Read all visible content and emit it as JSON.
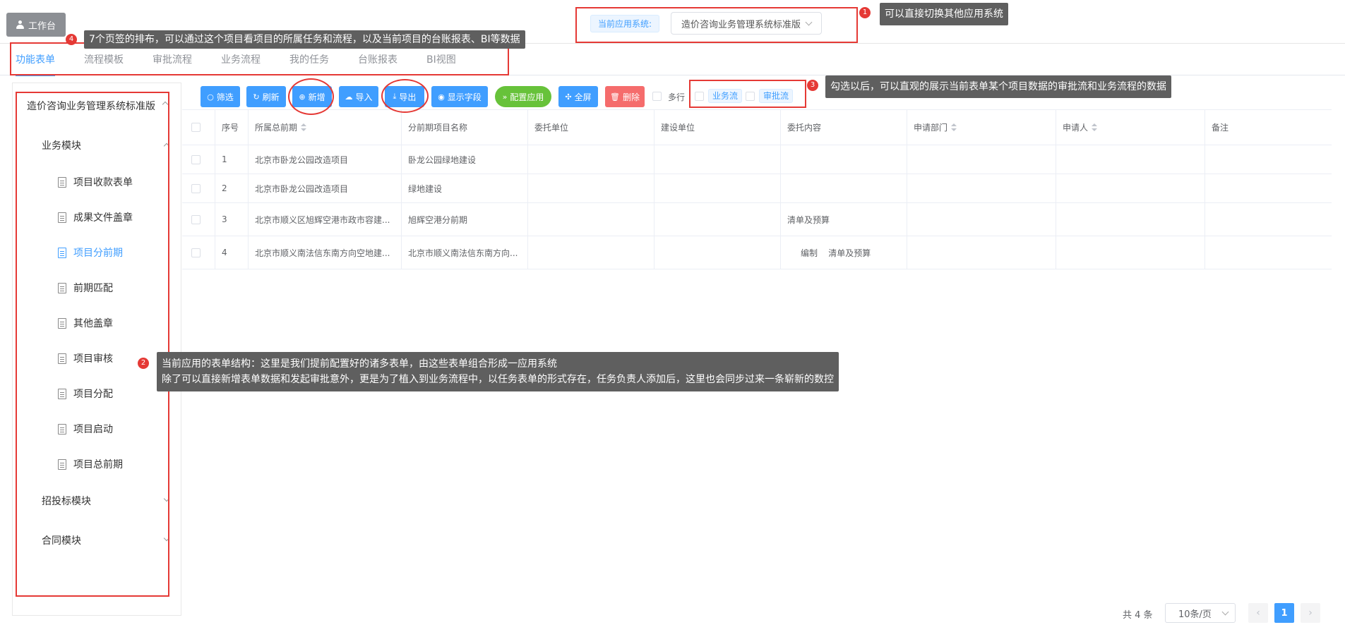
{
  "header": {
    "workbench_label": "工作台",
    "app_label": "当前应用系统:",
    "app_value": "造价咨询业务管理系统标准版"
  },
  "tabs": [
    {
      "label": "功能表单",
      "active": true
    },
    {
      "label": "流程模板"
    },
    {
      "label": "审批流程"
    },
    {
      "label": "业务流程"
    },
    {
      "label": "我的任务"
    },
    {
      "label": "台账报表"
    },
    {
      "label": "BI视图"
    }
  ],
  "sidebar": {
    "title": "造价咨询业务管理系统标准版",
    "module_business": "业务模块",
    "items": [
      "项目收款表单",
      "成果文件盖章",
      "项目分前期",
      "前期匹配",
      "其他盖章",
      "项目审核",
      "项目分配",
      "项目启动",
      "项目总前期"
    ],
    "active_item": "项目分前期",
    "module_bidding": "招投标模块",
    "module_contract": "合同模块"
  },
  "toolbar": {
    "filter": "筛选",
    "refresh": "刷新",
    "add": "新增",
    "import": "导入",
    "export": "导出",
    "fields": "显示字段",
    "config": "配置应用",
    "fullscreen": "全屏",
    "delete": "删除",
    "multi_row": "多行",
    "business_flow": "业务流",
    "approval_flow": "审批流"
  },
  "table": {
    "columns": [
      "序号",
      "所属总前期",
      "分前期项目名称",
      "委托单位",
      "建设单位",
      "委托内容",
      "申请部门",
      "申请人",
      "备注"
    ],
    "rows": [
      [
        "1",
        "北京市卧龙公园改造项目",
        "卧龙公园绿地建设",
        "",
        "",
        "",
        "",
        "",
        ""
      ],
      [
        "2",
        "北京市卧龙公园改造项目",
        "绿地建设",
        "",
        "",
        "",
        "",
        "",
        ""
      ],
      [
        "3",
        "北京市顺义区旭辉空港市政市容建...",
        "旭辉空港分前期",
        "",
        "",
        "清单及预算",
        "",
        "",
        ""
      ],
      [
        "4",
        "北京市顺义南法信东南方向空地建...",
        "北京市顺义南法信东南方向...",
        "",
        "",
        "编制    清单及预算",
        "",
        "",
        ""
      ]
    ]
  },
  "pagination": {
    "total": "共 4 条",
    "page_size": "10条/页",
    "current": "1",
    "prev": "‹",
    "next": "›"
  },
  "annotations": {
    "n1": "1",
    "n1_text": "可以直接切换其他应用系统",
    "n2": "2",
    "n2_line1": "当前应用的表单结构：这里是我们提前配置好的诸多表单，由这些表单组合形成一应用系统",
    "n2_line2": "除了可以直接新增表单数据和发起审批意外，更是为了植入到业务流程中，以任务表单的形式存在，任务负责人添加后，这里也会同步过来一条崭新的数控",
    "n3": "3",
    "n3_text": "勾选以后，可以直观的展示当前表单某个项目数据的审批流和业务流程的数据",
    "n4": "4",
    "n4_text": "7个页签的排布，可以通过这个项目看项目的所属任务和流程，以及当前项目的台账报表、BI等数据"
  }
}
